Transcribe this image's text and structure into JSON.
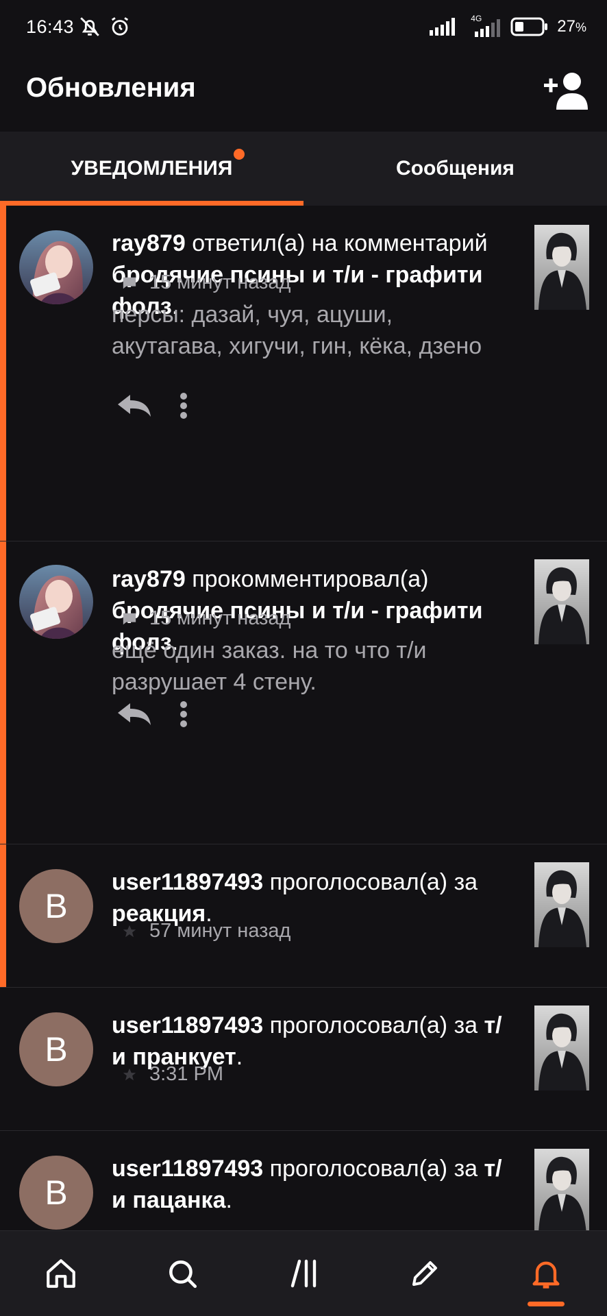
{
  "status_bar": {
    "time": "16:43",
    "battery": "27",
    "battery_unit": "%",
    "network": "4G",
    "icons": [
      "bell-muted-icon",
      "alarm-icon",
      "signal-icon",
      "signal-4g-icon",
      "battery-icon"
    ]
  },
  "header": {
    "title": "Обновления",
    "add_user_icon": "add-user-icon"
  },
  "tabs": [
    {
      "label": "УВЕДОМЛЕНИЯ",
      "active": true,
      "has_dot": true
    },
    {
      "label": "Сообщения",
      "active": false,
      "has_dot": false
    }
  ],
  "colors": {
    "accent": "#ff6a27",
    "background": "#121114",
    "surface": "#1d1c20",
    "secondary_text": "#a9a8ad",
    "avatar_letter_bg": "#8d6e63"
  },
  "notifications": [
    {
      "user": "ray879",
      "action": "ответил(а) на комментарий",
      "target": "бродячие псины и т/и - графити фолз",
      "end": ".",
      "meta_icon": "comment-icon",
      "time": "15 минут назад",
      "excerpt": "персы: дазай, чуя, ацуши, акутагава, хигучи, гин, кёка, дзено",
      "unread": true
    },
    {
      "user": "ray879",
      "action": "прокомментировал(а)",
      "target": "бродячие псины и т/и - графити фолз",
      "end": ".",
      "meta_icon": "comment-icon",
      "time": "15 минут назад",
      "excerpt": "ещё один заказ. на то что т/и разрушает 4 стену.",
      "unread": true
    },
    {
      "user": "user11897493",
      "action": "проголосовал(а) за",
      "target": "реакция",
      "end": ".",
      "avatar_letter": "B",
      "meta_icon": "star-icon",
      "time": "57 минут назад",
      "unread": true
    },
    {
      "user": "user11897493",
      "action": "проголосовал(а) за",
      "target": "т/и пранкует",
      "end": ".",
      "avatar_letter": "B",
      "meta_icon": "star-icon",
      "time": "3:31 PM",
      "unread": false
    },
    {
      "user": "user11897493",
      "action": "проголосовал(а) за",
      "target": "т/и пацанка",
      "end": ".",
      "avatar_letter": "B",
      "unread": false
    }
  ],
  "bottom_nav": [
    {
      "icon": "home-icon",
      "active": false
    },
    {
      "icon": "search-icon",
      "active": false
    },
    {
      "icon": "library-icon",
      "active": false
    },
    {
      "icon": "pencil-icon",
      "active": false
    },
    {
      "icon": "bell-icon",
      "active": true
    }
  ]
}
